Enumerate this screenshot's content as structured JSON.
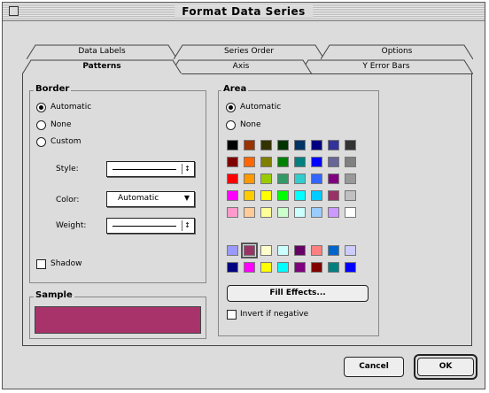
{
  "window": {
    "title": "Format Data Series"
  },
  "tabs_back": [
    {
      "label": "Data Labels"
    },
    {
      "label": "Series Order"
    },
    {
      "label": "Options"
    }
  ],
  "tabs_front": [
    {
      "label": "Patterns",
      "selected": true
    },
    {
      "label": "Axis"
    },
    {
      "label": "Y Error Bars"
    }
  ],
  "border": {
    "title": "Border",
    "options": [
      {
        "label": "Automatic",
        "selected": true
      },
      {
        "label": "None",
        "selected": false
      },
      {
        "label": "Custom",
        "selected": false
      }
    ],
    "style_label": "Style:",
    "color_label": "Color:",
    "color_value": "Automatic",
    "weight_label": "Weight:",
    "shadow_label": "Shadow"
  },
  "sample": {
    "title": "Sample",
    "color": "#a8336a"
  },
  "area": {
    "title": "Area",
    "options": [
      {
        "label": "Automatic",
        "selected": true
      },
      {
        "label": "None",
        "selected": false
      }
    ],
    "palette_main": [
      [
        "#000000",
        "#993300",
        "#333300",
        "#003300",
        "#003366",
        "#000080",
        "#333399",
        "#333333"
      ],
      [
        "#800000",
        "#ff6600",
        "#808000",
        "#008000",
        "#008080",
        "#0000ff",
        "#666699",
        "#808080"
      ],
      [
        "#ff0000",
        "#ff9900",
        "#99cc00",
        "#339966",
        "#33cccc",
        "#3366ff",
        "#800080",
        "#999999"
      ],
      [
        "#ff00ff",
        "#ffcc00",
        "#ffff00",
        "#00ff00",
        "#00ffff",
        "#00ccff",
        "#993366",
        "#c0c0c0"
      ],
      [
        "#ff99cc",
        "#ffcc99",
        "#ffff99",
        "#ccffcc",
        "#ccffff",
        "#99ccff",
        "#cc99ff",
        "#ffffff"
      ]
    ],
    "palette_chart": [
      [
        "#9999ff",
        "#993366",
        "#ffffcc",
        "#ccffff",
        "#660066",
        "#ff8080",
        "#0066cc",
        "#ccccff"
      ],
      [
        "#000080",
        "#ff00ff",
        "#ffff00",
        "#00ffff",
        "#800080",
        "#800000",
        "#008080",
        "#0000ff"
      ]
    ],
    "selected_swatch": "chart-0-1",
    "fill_effects_label": "Fill Effects...",
    "invert_label": "Invert if negative"
  },
  "buttons": {
    "cancel": "Cancel",
    "ok": "OK"
  }
}
